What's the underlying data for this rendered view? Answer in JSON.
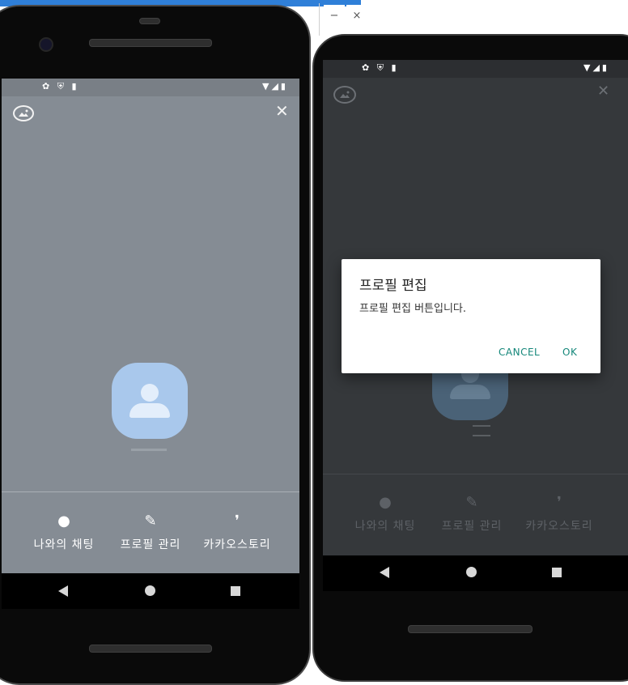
{
  "window": {
    "minimize_label": "−",
    "close_label": "×"
  },
  "phone_left": {
    "status_icons_left": "✿ ⛨ ▮",
    "status_icons_right": "▼◢▮",
    "close_label": "✕",
    "menu": [
      {
        "icon": "speech-bubble-icon",
        "glyph": "●",
        "label": "나와의 채팅"
      },
      {
        "icon": "pencil-icon",
        "glyph": "✎",
        "label": "프로필 관리"
      },
      {
        "icon": "quote-icon",
        "glyph": "❜",
        "label": "카카오스토리"
      }
    ]
  },
  "phone_right": {
    "status_icons_left": "✿ ⛨ ▮",
    "status_icons_right": "▼◢▮",
    "close_label": "✕",
    "dialog": {
      "title": "프로필 편집",
      "message": "프로필 편집 버튼입니다.",
      "cancel_label": "CANCEL",
      "ok_label": "OK"
    },
    "menu": [
      {
        "icon": "speech-bubble-icon",
        "glyph": "●",
        "label": "나와의 채팅"
      },
      {
        "icon": "pencil-icon",
        "glyph": "✎",
        "label": "프로필 관리"
      },
      {
        "icon": "quote-icon",
        "glyph": "❜",
        "label": "카카오스토리"
      }
    ]
  },
  "colors": {
    "screen_left_bg": "#858c94",
    "screen_right_bg": "#35383b",
    "avatar_left": "#a9c8ec",
    "avatar_right": "#4a6277",
    "dialog_button": "#15877a"
  }
}
